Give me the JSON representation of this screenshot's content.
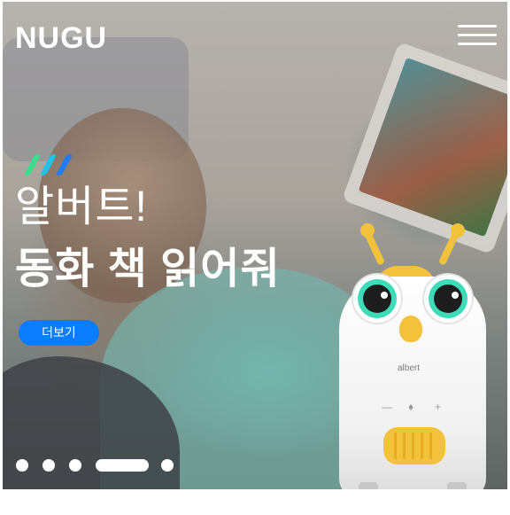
{
  "header": {
    "logo": "NUGU",
    "menu_icon": "hamburger-menu-icon"
  },
  "hero": {
    "accent_icon": "slash-accent-icon",
    "accent_colors": [
      "#3ddb8a",
      "#22c1e8",
      "#1f7cf2"
    ],
    "title_line1": "알버트!",
    "title_line2": "동화 책 읽어줘",
    "more_button": "더보기",
    "more_button_color": "#0a7cff"
  },
  "product": {
    "brand_label": "albert",
    "accent_color": "#f3c23d"
  },
  "carousel": {
    "total_slides": 5,
    "active_index": 3
  }
}
